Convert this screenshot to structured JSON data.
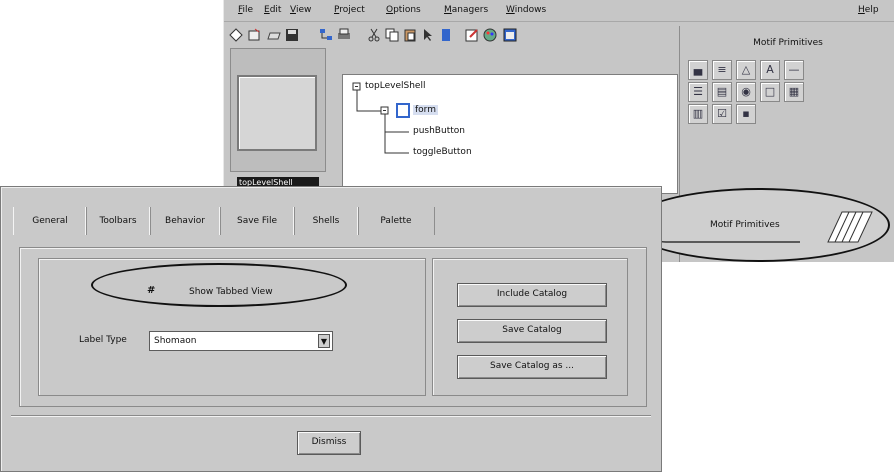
{
  "main_window": {
    "menu": [
      {
        "label": "File",
        "mnemonic": "F"
      },
      {
        "label": "Edit",
        "mnemonic": "E"
      },
      {
        "label": "View",
        "mnemonic": "V"
      },
      {
        "label": "Project",
        "mnemonic": "P"
      },
      {
        "label": "Options",
        "mnemonic": "O"
      },
      {
        "label": "Managers",
        "mnemonic": "M"
      },
      {
        "label": "Windows",
        "mnemonic": "W"
      },
      {
        "label": "Help",
        "mnemonic": "H"
      }
    ],
    "toolbar_icons": [
      "shape-icon",
      "new-icon",
      "open-icon",
      "save-icon",
      "tree-icon",
      "print-icon",
      "cut-icon",
      "copy-icon",
      "paste-icon",
      "pointer-icon",
      "flag-icon",
      "edit-icon",
      "palette-icon",
      "window-icon"
    ],
    "preview_label": "topLevelShell",
    "tree": {
      "root": "topLevelShell",
      "form": "form",
      "children": [
        "pushButton",
        "toggleButton"
      ]
    },
    "palette": {
      "title": "Motif Primitives",
      "icons": [
        {
          "name": "bar-icon",
          "glyph": "▄"
        },
        {
          "name": "scrollbar-icon",
          "glyph": "≡"
        },
        {
          "name": "triangle-icon",
          "glyph": "△"
        },
        {
          "name": "label-a-icon",
          "glyph": "A"
        },
        {
          "name": "separator-icon",
          "glyph": "—"
        },
        {
          "name": "list-icon",
          "glyph": "☰"
        },
        {
          "name": "text-icon",
          "glyph": "▤"
        },
        {
          "name": "arrow-button-icon",
          "glyph": "◉"
        },
        {
          "name": "page-icon",
          "glyph": "□"
        },
        {
          "name": "frame-icon",
          "glyph": "▦"
        },
        {
          "name": "grid-icon",
          "glyph": "▥"
        },
        {
          "name": "toggle-icon",
          "glyph": "☑"
        },
        {
          "name": "drawn-button-icon",
          "glyph": "▪"
        }
      ]
    }
  },
  "annotation": {
    "motif_label": "Motif Primitives"
  },
  "dialog": {
    "tabs": [
      "General",
      "Toolbars",
      "Behavior",
      "Save File",
      "Shells",
      "Palette"
    ],
    "show_tabbed_view": {
      "label": "Show Tabbed View",
      "mark": "#"
    },
    "label_type": {
      "label": "Label Type",
      "value": "Shomaon"
    },
    "buttons": {
      "include_catalog": "Include Catalog",
      "save_catalog": "Save Catalog",
      "save_catalog_as": "Save Catalog as ..."
    },
    "dismiss": "Dismiss"
  }
}
